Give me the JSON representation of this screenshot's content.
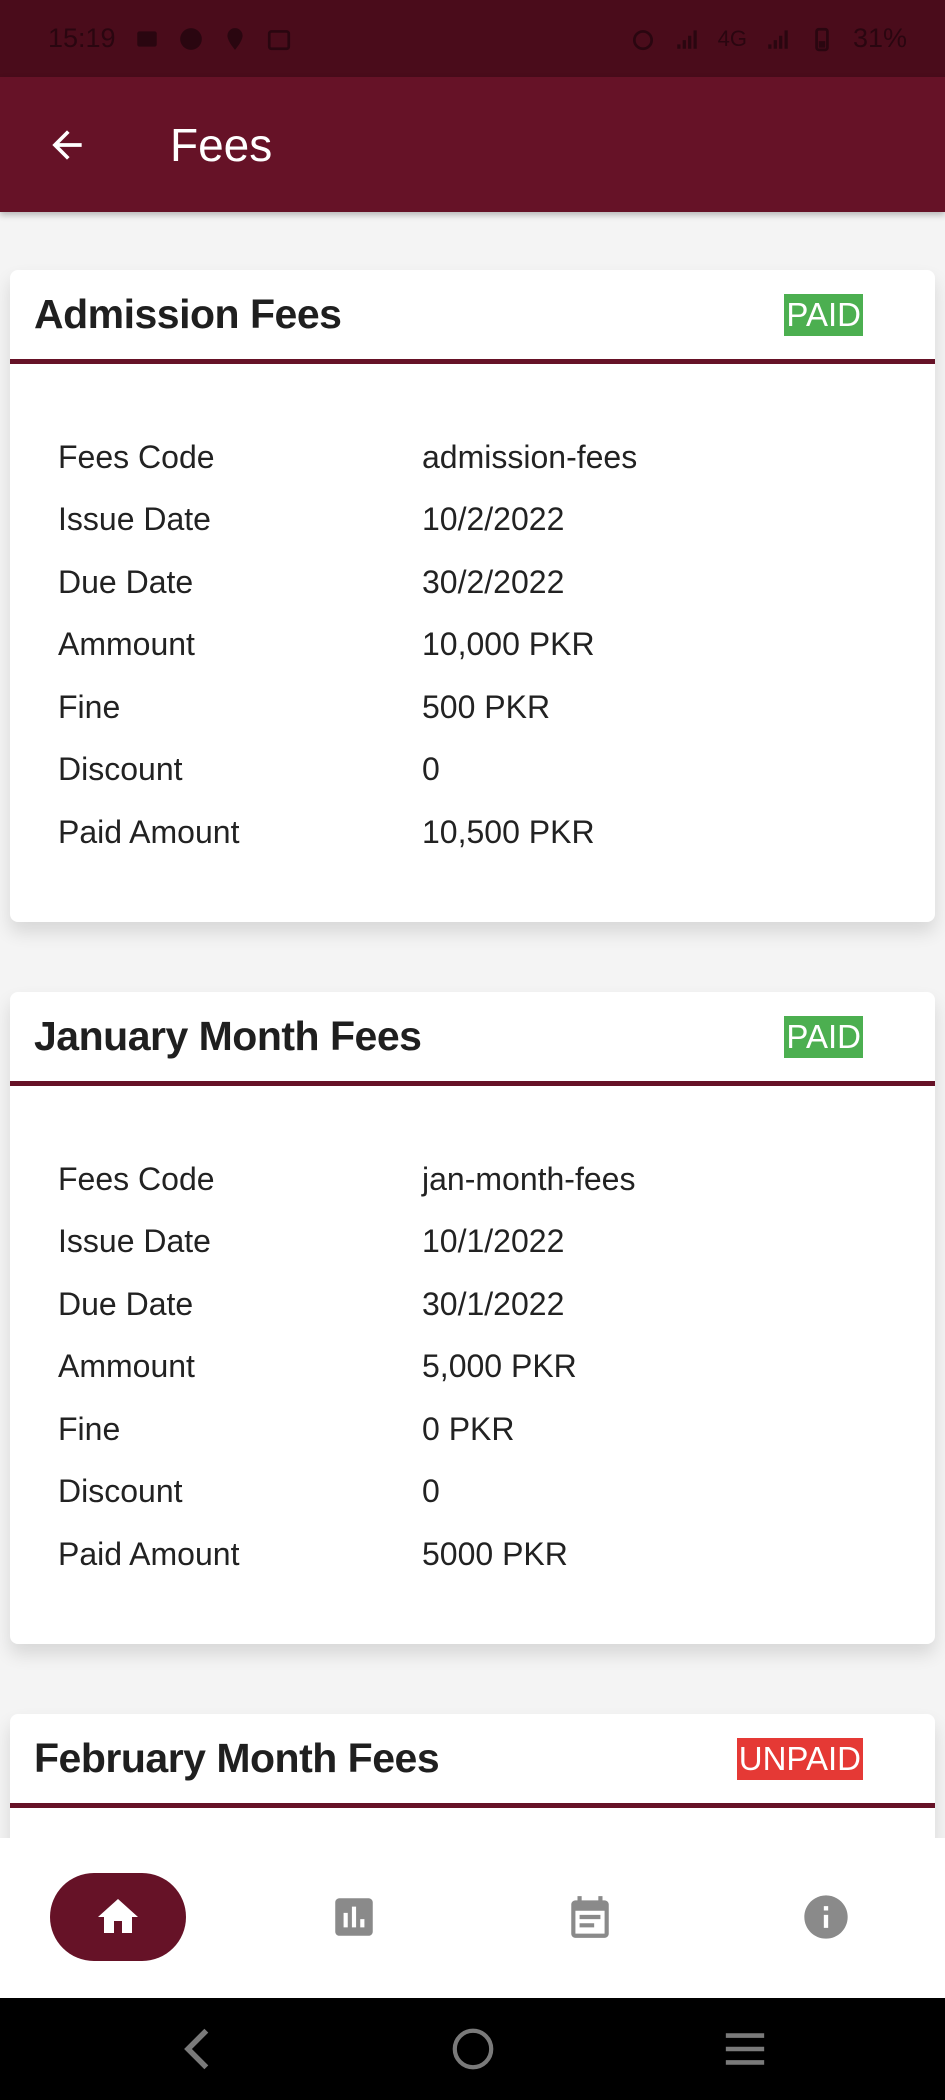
{
  "status_bar": {
    "time": "15:19",
    "battery": "31%",
    "network": "4G"
  },
  "app_bar": {
    "title": "Fees"
  },
  "fees": [
    {
      "title": "Admission Fees",
      "status": "PAID",
      "rows": [
        {
          "label": "Fees Code",
          "value": "admission-fees"
        },
        {
          "label": "Issue Date",
          "value": "10/2/2022"
        },
        {
          "label": "Due Date",
          "value": "30/2/2022"
        },
        {
          "label": "Ammount",
          "value": "10,000 PKR"
        },
        {
          "label": "Fine",
          "value": "500 PKR"
        },
        {
          "label": "Discount",
          "value": "0"
        },
        {
          "label": "Paid Amount",
          "value": "10,500 PKR"
        }
      ]
    },
    {
      "title": "January Month Fees",
      "status": "PAID",
      "rows": [
        {
          "label": "Fees Code",
          "value": "jan-month-fees"
        },
        {
          "label": "Issue Date",
          "value": "10/1/2022"
        },
        {
          "label": "Due Date",
          "value": "30/1/2022"
        },
        {
          "label": "Ammount",
          "value": "5,000 PKR"
        },
        {
          "label": "Fine",
          "value": "0 PKR"
        },
        {
          "label": "Discount",
          "value": "0"
        },
        {
          "label": "Paid Amount",
          "value": "5000 PKR"
        }
      ]
    },
    {
      "title": "February Month Fees",
      "status": "UNPAID",
      "rows": []
    }
  ],
  "bottom_nav": {
    "items": [
      {
        "icon": "home-icon",
        "active": true
      },
      {
        "icon": "bar-chart-icon",
        "active": false
      },
      {
        "icon": "calendar-icon",
        "active": false
      },
      {
        "icon": "info-icon",
        "active": false
      }
    ]
  },
  "colors": {
    "primary": "#661227",
    "status_bar": "#4a0c1b",
    "paid": "#4caf50",
    "unpaid": "#e53935"
  }
}
